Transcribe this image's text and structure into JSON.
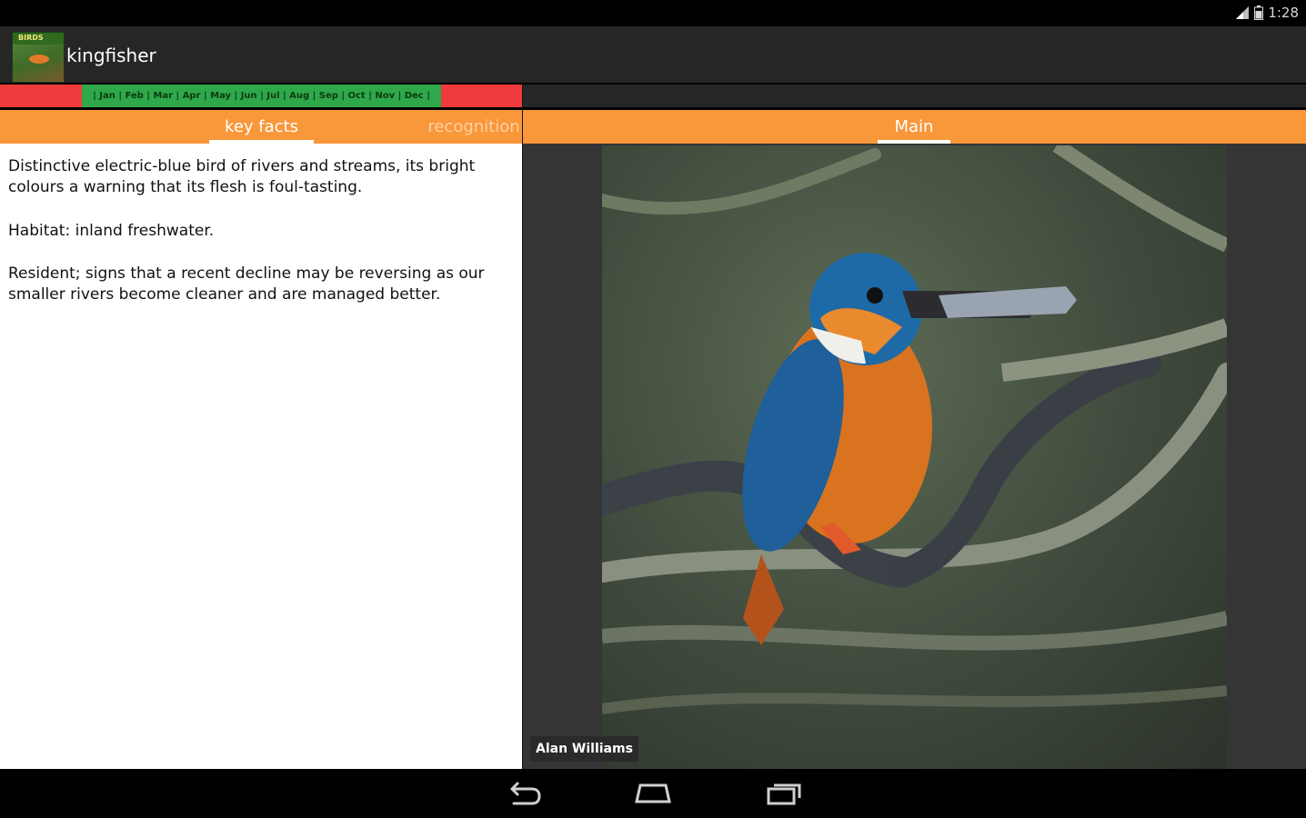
{
  "status_bar": {
    "time": "1:28",
    "icons": [
      "signal-icon",
      "battery-icon"
    ]
  },
  "action_bar": {
    "app_icon": "kingfisher-app-icon",
    "app_icon_text": "BIRDS",
    "title": "kingfisher"
  },
  "months": {
    "text": "| Jan | Feb | Mar | Apr | May | Jun | Jul | Aug | Sep | Oct | Nov | Dec |",
    "absent_color": "#ef3b3b",
    "present_color": "#2ea84a"
  },
  "left_tabs": {
    "active": "key facts",
    "next": "recognition"
  },
  "right_tabs": {
    "active": "Main"
  },
  "key_facts": {
    "description": "Distinctive electric-blue bird of rivers and streams, its bright colours a warning that its flesh is foul-tasting.",
    "habitat": "Habitat: inland freshwater.",
    "status": "Resident; signs that a recent decline may be reversing as our smaller rivers become cleaner and are managed better."
  },
  "photo": {
    "subject": "kingfisher perched on branch with fish",
    "credit": "Alan Williams"
  },
  "nav": {
    "icons": [
      "back-icon",
      "home-icon",
      "recent-apps-icon"
    ]
  },
  "colors": {
    "tab_bar": "#f9973b",
    "action_bar": "#262626"
  }
}
